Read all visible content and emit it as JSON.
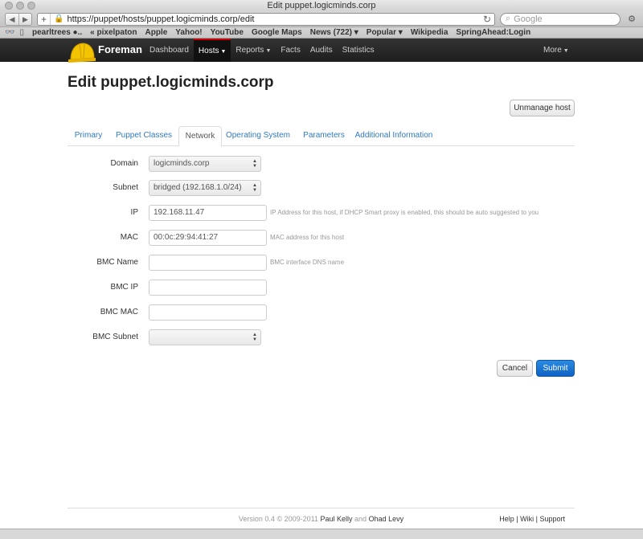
{
  "browser": {
    "title": "Edit puppet.logicminds.corp",
    "url": "https://puppet/hosts/puppet.logicminds.corp/edit",
    "search_placeholder": "Google",
    "bookmarks": [
      "pearltrees ●..",
      "« pixelpaton",
      "Apple",
      "Yahoo!",
      "YouTube",
      "Google Maps",
      "News (722) ▾",
      "Popular ▾",
      "Wikipedia",
      "SpringAhead:Login"
    ]
  },
  "navbar": {
    "brand": "Foreman",
    "links": [
      "Dashboard",
      "Hosts",
      "Reports",
      "Facts",
      "Audits",
      "Statistics"
    ],
    "active": "Hosts",
    "more": "More"
  },
  "page": {
    "title": "Edit puppet.logicminds.corp",
    "unmanage_label": "Unmanage host"
  },
  "tabs": [
    "Primary",
    "Puppet Classes",
    "Network",
    "Operating System",
    "Parameters",
    "Additional Information"
  ],
  "active_tab": "Network",
  "form": {
    "domain": {
      "label": "Domain",
      "value": "logicminds.corp"
    },
    "subnet": {
      "label": "Subnet",
      "value": "bridged (192.168.1.0/24)"
    },
    "ip": {
      "label": "IP",
      "value": "192.168.11.47",
      "hint": "IP Address for this host, if DHCP Smart proxy is enabled, this should be auto suggested to you"
    },
    "mac": {
      "label": "MAC",
      "value": "00:0c:29:94:41:27",
      "hint": "MAC address for this host"
    },
    "bmc_name": {
      "label": "BMC Name",
      "value": "",
      "hint": "BMC interface DNS name"
    },
    "bmc_ip": {
      "label": "BMC IP",
      "value": ""
    },
    "bmc_mac": {
      "label": "BMC MAC",
      "value": ""
    },
    "bmc_subnet": {
      "label": "BMC Subnet",
      "value": ""
    }
  },
  "actions": {
    "cancel": "Cancel",
    "submit": "Submit"
  },
  "footer": {
    "version_text": "Version 0.4 © 2009-2011",
    "author1": "Paul Kelly",
    "and": "and",
    "author2": "Ohad Levy",
    "help": "Help",
    "wiki": "Wiki",
    "support": "Support"
  },
  "colors": {
    "primary": "#0f63c5",
    "link": "#2f7ac4",
    "navbar": "#1e1e1e",
    "active_tab_marker": "#cc0000"
  }
}
